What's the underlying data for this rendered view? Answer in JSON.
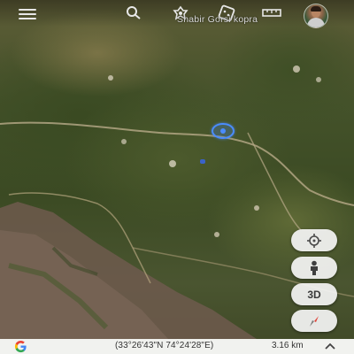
{
  "header": {
    "place_label": "Shabir Gorsi kopra",
    "icons": [
      "menu-icon",
      "search-icon",
      "voyager-icon",
      "feeling-lucky-icon",
      "measure-icon",
      "account-avatar"
    ]
  },
  "map": {
    "imagery": "satellite",
    "my_location_color": "#4a8cff"
  },
  "controls": {
    "reset_view_icon": "reset-view-icon",
    "pegman_icon": "pegman-icon",
    "three_d_label": "3D",
    "compass_icon": "compass-icon"
  },
  "footer": {
    "coordinates": "(33°26'43\"N 74°24'28\"E)",
    "scale": "3.16 km",
    "expand_icon": "chevron-up-icon"
  }
}
